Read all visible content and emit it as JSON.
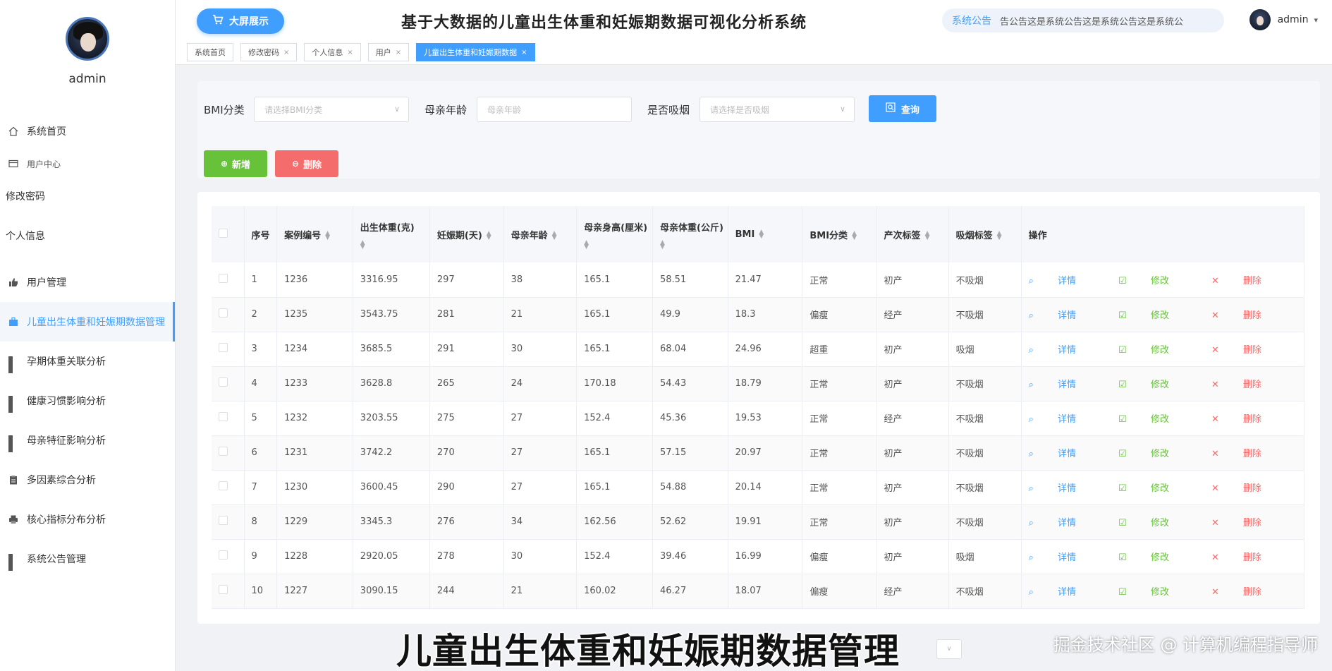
{
  "sidebar": {
    "username": "admin",
    "items": [
      {
        "label": "系统首页",
        "icon": "home-icon"
      },
      {
        "label": "用户中心",
        "icon": "card-icon"
      },
      {
        "label": "修改密码",
        "icon": ""
      },
      {
        "label": "个人信息",
        "icon": ""
      },
      {
        "label": "用户管理",
        "icon": "thumb-icon"
      },
      {
        "label": "儿童出生体重和妊娠期数据管理",
        "icon": "briefcase-icon"
      },
      {
        "label": "孕期体重关联分析",
        "icon": "grid-icon"
      },
      {
        "label": "健康习惯影响分析",
        "icon": "grid-icon"
      },
      {
        "label": "母亲特征影响分析",
        "icon": "grid-icon"
      },
      {
        "label": "多因素综合分析",
        "icon": "clipboard-icon"
      },
      {
        "label": "核心指标分布分析",
        "icon": "printer-icon"
      },
      {
        "label": "系统公告管理",
        "icon": "grid-icon"
      }
    ]
  },
  "header": {
    "bigscreen_label": "大屏展示",
    "title": "基于大数据的儿童出生体重和妊娠期数据可视化分析系统",
    "notice_label": "系统公告",
    "notice_text": "告公告这是系统公告这是系统公告这是系统公",
    "username": "admin"
  },
  "tabs": [
    {
      "label": "系统首页",
      "closable": false
    },
    {
      "label": "修改密码",
      "closable": true
    },
    {
      "label": "个人信息",
      "closable": true
    },
    {
      "label": "用户",
      "closable": true
    },
    {
      "label": "儿童出生体重和妊娠期数据",
      "closable": true,
      "active": true
    }
  ],
  "search": {
    "bmi_label": "BMI分类",
    "bmi_placeholder": "请选择BMI分类",
    "age_label": "母亲年龄",
    "age_placeholder": "母亲年龄",
    "smoke_label": "是否吸烟",
    "smoke_placeholder": "请选择是否吸烟",
    "query_label": "查询",
    "add_label": "新增",
    "delete_label": "删除"
  },
  "table": {
    "columns": [
      "序号",
      "案例编号",
      "出生体重(克)",
      "妊娠期(天)",
      "母亲年龄",
      "母亲身高(厘米)",
      "母亲体重(公斤)",
      "BMI",
      "BMI分类",
      "产次标签",
      "吸烟标签",
      "操作"
    ],
    "actions": {
      "detail": "详情",
      "edit": "修改",
      "remove": "删除"
    },
    "rows": [
      [
        "1",
        "1236",
        "3316.95",
        "297",
        "38",
        "165.1",
        "58.51",
        "21.47",
        "正常",
        "初产",
        "不吸烟"
      ],
      [
        "2",
        "1235",
        "3543.75",
        "281",
        "21",
        "165.1",
        "49.9",
        "18.3",
        "偏瘦",
        "经产",
        "不吸烟"
      ],
      [
        "3",
        "1234",
        "3685.5",
        "291",
        "30",
        "165.1",
        "68.04",
        "24.96",
        "超重",
        "初产",
        "吸烟"
      ],
      [
        "4",
        "1233",
        "3628.8",
        "265",
        "24",
        "170.18",
        "54.43",
        "18.79",
        "正常",
        "初产",
        "不吸烟"
      ],
      [
        "5",
        "1232",
        "3203.55",
        "275",
        "27",
        "152.4",
        "45.36",
        "19.53",
        "正常",
        "经产",
        "不吸烟"
      ],
      [
        "6",
        "1231",
        "3742.2",
        "270",
        "27",
        "165.1",
        "57.15",
        "20.97",
        "正常",
        "初产",
        "不吸烟"
      ],
      [
        "7",
        "1230",
        "3600.45",
        "290",
        "27",
        "165.1",
        "54.88",
        "20.14",
        "正常",
        "初产",
        "不吸烟"
      ],
      [
        "8",
        "1229",
        "3345.3",
        "276",
        "34",
        "162.56",
        "52.62",
        "19.91",
        "正常",
        "初产",
        "不吸烟"
      ],
      [
        "9",
        "1228",
        "2920.05",
        "278",
        "30",
        "152.4",
        "39.46",
        "16.99",
        "偏瘦",
        "初产",
        "吸烟"
      ],
      [
        "10",
        "1227",
        "3090.15",
        "244",
        "21",
        "160.02",
        "46.27",
        "18.07",
        "偏瘦",
        "经产",
        "不吸烟"
      ]
    ]
  },
  "overlay": {
    "caption": "儿童出生体重和妊娠期数据管理",
    "watermark": "掘金技术社区 @ 计算机编程指导师"
  },
  "colors": {
    "primary": "#409eff",
    "success": "#67c23a",
    "danger": "#f56c6c"
  }
}
